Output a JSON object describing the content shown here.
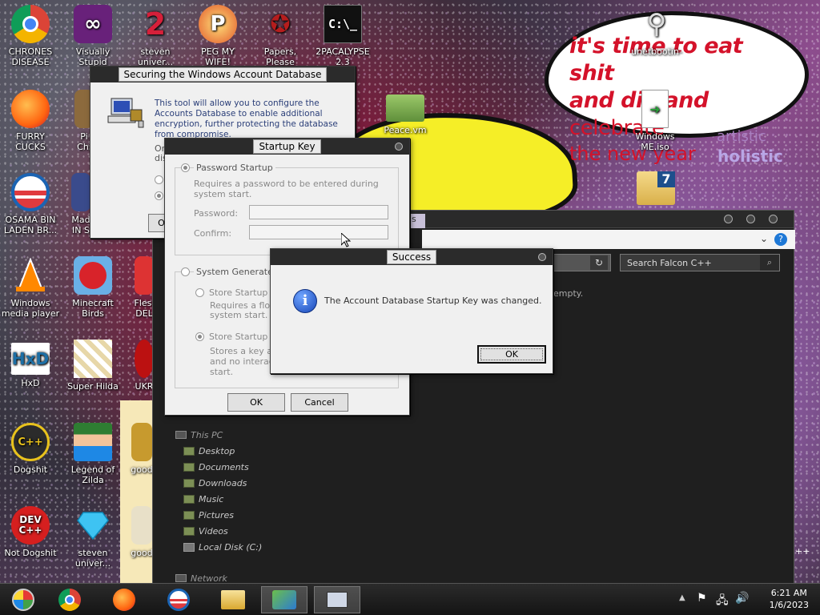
{
  "desktop": {
    "icons": [
      {
        "label": "CHRONES DISEASE",
        "icon": "chrome-icon"
      },
      {
        "label": "FURRY CUCKS",
        "icon": "firefox-icon"
      },
      {
        "label": "OSAMA BIN LADEN BR...",
        "icon": "obama-logo-icon"
      },
      {
        "label": "Windows media player",
        "icon": "vlc-cone-icon"
      },
      {
        "label": "HxD",
        "icon": "hxd-icon"
      },
      {
        "label": "Dogshit",
        "icon": "cpp-icon"
      },
      {
        "label": "Not Dogshit",
        "icon": "devcpp-icon"
      },
      {
        "label": "Visually Stupid",
        "icon": "visual-studio-icon"
      },
      {
        "label": "Minecraft Birds",
        "icon": "angry-bird-icon"
      },
      {
        "label": "Super Hilda",
        "icon": "pixel-dog-icon"
      },
      {
        "label": "Legend of Zilda",
        "icon": "pixel-hero-icon"
      },
      {
        "label": "steven univer...",
        "icon": "diamond-icon"
      },
      {
        "label": "steven univer...",
        "icon": "steven-icon"
      },
      {
        "label": "PEG MY WIFE!",
        "icon": "peggle-icon"
      },
      {
        "label": "Papers, Please",
        "icon": "papers-please-icon"
      },
      {
        "label": "2PACALYPSE 2.3",
        "icon": "terminal-icon"
      },
      {
        "label": "unetbootin-",
        "icon": "satellite-icon"
      },
      {
        "label": "Peace.vm",
        "icon": "folder-icon"
      },
      {
        "label": "Windows ME.iso",
        "icon": "iso-file-icon"
      },
      {
        "label": "Pi Chi",
        "icon": "partial-icon"
      },
      {
        "label": "Mad IN S",
        "icon": "partial-icon"
      },
      {
        "label": "Flesl DEL",
        "icon": "partial-icon"
      },
      {
        "label": "UKR",
        "icon": "partial-icon"
      },
      {
        "label": "good",
        "icon": "partial-icon"
      },
      {
        "label": "good",
        "icon": "partial-icon"
      }
    ],
    "bubble": {
      "line1": "it's time to eat shit",
      "line2a": "and die and ",
      "line2b": "celebrate",
      "line3": "the new year"
    },
    "bg_text": [
      "artistic",
      "holistic"
    ]
  },
  "account_db_window": {
    "title": "Securing the Windows Account Database",
    "description": "This tool will allow you to configure the Accounts Database to enable additional encryption, further protecting the database from compromise.",
    "partial_line1": "Or",
    "partial_line2": "dis",
    "ok_partial": "Ol"
  },
  "startup_key_window": {
    "title": "Startup Key",
    "password_startup": {
      "label": "Password Startup",
      "desc": "Requires a password to be entered during system start.",
      "password_label": "Password:",
      "confirm_label": "Confirm:"
    },
    "system_generated": {
      "label": "System Generated P",
      "store_floppy": "Store Startup Ke",
      "store_floppy_desc1": "Requires a flopp",
      "store_floppy_desc2": "system start.",
      "store_local": "Store Startup Ke",
      "store_local_desc1": "Stores a key as",
      "store_local_desc2": "and no interacti",
      "store_local_desc3": "start."
    },
    "ok": "OK",
    "cancel": "Cancel"
  },
  "success_dialog": {
    "title": "Success",
    "message": "The Account Database Startup Key was changed.",
    "ok": "OK"
  },
  "explorer": {
    "tab_fragment": "ls",
    "search_placeholder": "Search Falcon C++",
    "empty_fragment": "empty.",
    "nav": {
      "this_pc": "This PC",
      "items": [
        "Desktop",
        "Documents",
        "Downloads",
        "Music",
        "Pictures",
        "Videos",
        "Local Disk (C:)"
      ],
      "network": "Network"
    },
    "corner_fragment": "++"
  },
  "taskbar": {
    "time": "6:21 AM",
    "date": "1/6/2023",
    "colors": {
      "accent": "#2b2b2b"
    }
  }
}
